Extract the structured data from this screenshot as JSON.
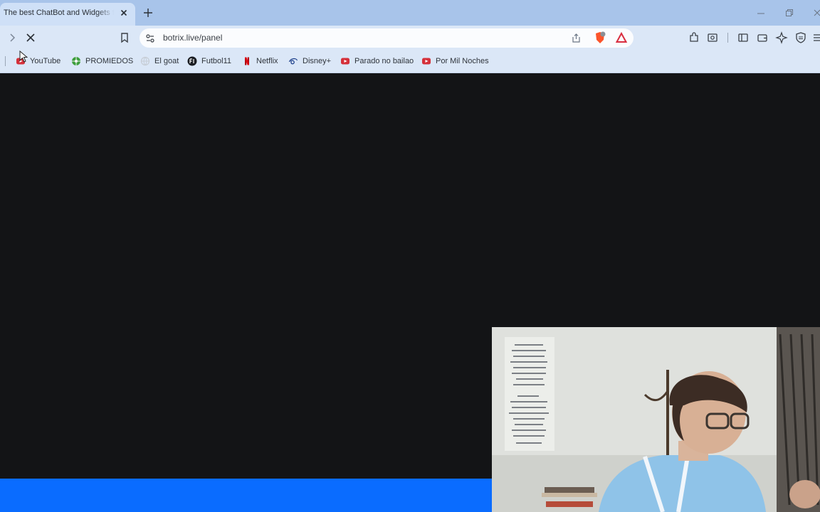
{
  "browser": {
    "tab": {
      "title": "The best ChatBot and Widgets fo"
    },
    "address_bar": {
      "url": "botrix.live/panel"
    },
    "bookmarks": [
      {
        "label": "YouTube",
        "icon": "youtube-icon"
      },
      {
        "label": "PROMIEDOS",
        "icon": "promiedos-icon"
      },
      {
        "label": "El goat",
        "icon": "globe-icon"
      },
      {
        "label": "Futbol11",
        "icon": "futbol11-icon"
      },
      {
        "label": "Netflix",
        "icon": "netflix-icon"
      },
      {
        "label": "Disney+",
        "icon": "disney-icon"
      },
      {
        "label": "Parado no bailao",
        "icon": "youtube-icon"
      },
      {
        "label": "Por Mil Noches",
        "icon": "youtube-icon"
      }
    ],
    "colors": {
      "tab_strip": "#a8c4ea",
      "toolbar": "#dbe7f7",
      "page_background": "#131416",
      "loading_bar": "#0a6cff"
    }
  },
  "page": {
    "state": "loading"
  }
}
